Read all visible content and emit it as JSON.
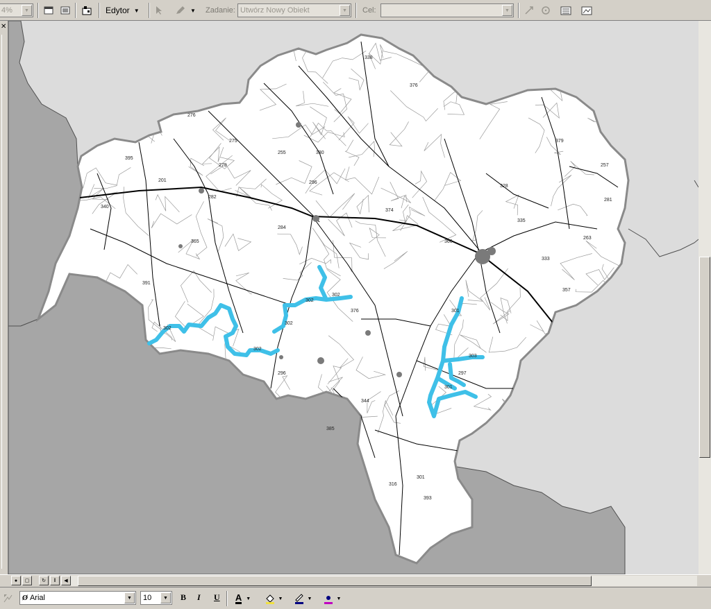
{
  "toolbar": {
    "zoom_value": "4%",
    "editor_label": "Edytor",
    "task_label": "Zadanie:",
    "task_value": "Utwórz Nowy Obiekt",
    "target_label": "Cel:",
    "target_value": ""
  },
  "map": {
    "road_labels": [
      "275",
      "255",
      "201",
      "276",
      "282",
      "284",
      "302",
      "302",
      "302",
      "302",
      "302",
      "296",
      "301",
      "303",
      "297",
      "301",
      "316",
      "301",
      "376",
      "385",
      "344",
      "393",
      "330",
      "376",
      "338",
      "379",
      "257",
      "281",
      "263",
      "333",
      "335",
      "328",
      "395",
      "340",
      "391",
      "365",
      "279",
      "374",
      "366",
      "357",
      "296"
    ]
  },
  "drawing_toolbar": {
    "font_name": "Arial",
    "font_size": "10",
    "bold_label": "B",
    "italic_label": "I",
    "underline_label": "U",
    "font_color_label": "A"
  },
  "colors": {
    "highlight_route": "#3fc0e8",
    "province_fill": "#ffffff",
    "outside_fill": "#a6a6a6",
    "background": "#dcdcdc"
  }
}
